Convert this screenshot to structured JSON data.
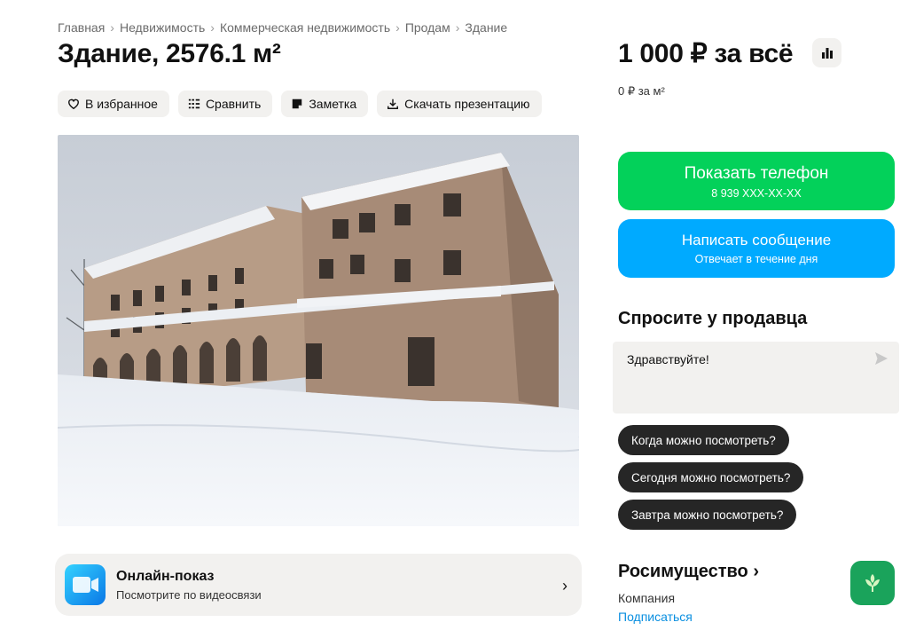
{
  "breadcrumbs": [
    "Главная",
    "Недвижимость",
    "Коммерческая недвижимость",
    "Продам",
    "Здание"
  ],
  "breadcrumb_separator": "›",
  "title": "Здание, 2576.1 м²",
  "actions": {
    "favorite": "В избранное",
    "compare": "Сравнить",
    "note": "Заметка",
    "download": "Скачать презентацию"
  },
  "photo_icon": "building-photo",
  "online_show": {
    "title": "Онлайн-показ",
    "subtitle": "Посмотрите по видеосвязи"
  },
  "price": {
    "total": "1 000 ₽ за всё",
    "per_sqm": "0 ₽ за м²"
  },
  "buttons": {
    "phone_label": "Показать телефон",
    "phone_number": "8 939 XXX-XX-XX",
    "message_label": "Написать сообщение",
    "message_sub": "Отвечает в течение дня"
  },
  "ask": {
    "title": "Спросите у продавца",
    "message_value": "Здравствуйте!",
    "quick_questions": [
      "Когда можно посмотреть?",
      "Сегодня можно посмотреть?",
      "Завтра можно посмотреть?"
    ]
  },
  "seller": {
    "name": "Росимущество ›",
    "type": "Компания",
    "subscribe": "Подписаться"
  },
  "colors": {
    "phone_button": "#03d15a",
    "message_button": "#00aaff",
    "link": "#0a8fe0",
    "chip": "#f2f1ef",
    "pill": "#262626"
  }
}
